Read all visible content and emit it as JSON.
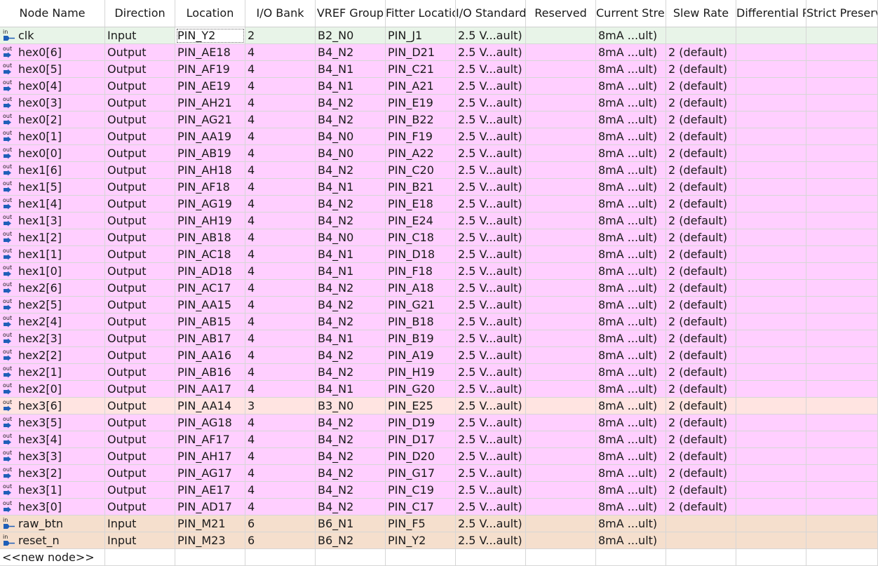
{
  "colors": {
    "input": "#e8f4e8",
    "output": "#ffcfff",
    "bank3": "#ffe4e1",
    "misc": "#f5dfcd",
    "icon": "#1f5fb8"
  },
  "columns": [
    {
      "label": "Node Name",
      "align": "center"
    },
    {
      "label": "Direction",
      "align": "center"
    },
    {
      "label": "Location",
      "align": "center"
    },
    {
      "label": "I/O Bank",
      "align": "center"
    },
    {
      "label": "VREF Group",
      "align": "clipl"
    },
    {
      "label": "Fitter Location",
      "align": "clipl"
    },
    {
      "label": "I/O Standard",
      "align": "clipl"
    },
    {
      "label": "Reserved",
      "align": "center"
    },
    {
      "label": "Current Strength",
      "align": "clipl"
    },
    {
      "label": "Slew Rate",
      "align": "center"
    },
    {
      "label": "Differential Pair",
      "align": "clipl"
    },
    {
      "label": "Strict Preservation",
      "align": "clipl"
    }
  ],
  "rows": [
    {
      "icon": "in",
      "name": "clk",
      "direction": "Input",
      "location": "PIN_Y2",
      "bank": "2",
      "vref": "B2_N0",
      "fitter": "PIN_J1",
      "iostd": "2.5 V...ault)",
      "reserved": "",
      "current": "8mA ...ult)",
      "slew": "",
      "diff": "",
      "strict": "",
      "color": "input",
      "selected": true
    },
    {
      "icon": "out",
      "name": "hex0[6]",
      "direction": "Output",
      "location": "PIN_AE18",
      "bank": "4",
      "vref": "B4_N2",
      "fitter": "PIN_D21",
      "iostd": "2.5 V...ault)",
      "reserved": "",
      "current": "8mA ...ult)",
      "slew": "2 (default)",
      "diff": "",
      "strict": "",
      "color": "output"
    },
    {
      "icon": "out",
      "name": "hex0[5]",
      "direction": "Output",
      "location": "PIN_AF19",
      "bank": "4",
      "vref": "B4_N1",
      "fitter": "PIN_C21",
      "iostd": "2.5 V...ault)",
      "reserved": "",
      "current": "8mA ...ult)",
      "slew": "2 (default)",
      "diff": "",
      "strict": "",
      "color": "output"
    },
    {
      "icon": "out",
      "name": "hex0[4]",
      "direction": "Output",
      "location": "PIN_AE19",
      "bank": "4",
      "vref": "B4_N1",
      "fitter": "PIN_A21",
      "iostd": "2.5 V...ault)",
      "reserved": "",
      "current": "8mA ...ult)",
      "slew": "2 (default)",
      "diff": "",
      "strict": "",
      "color": "output"
    },
    {
      "icon": "out",
      "name": "hex0[3]",
      "direction": "Output",
      "location": "PIN_AH21",
      "bank": "4",
      "vref": "B4_N2",
      "fitter": "PIN_E19",
      "iostd": "2.5 V...ault)",
      "reserved": "",
      "current": "8mA ...ult)",
      "slew": "2 (default)",
      "diff": "",
      "strict": "",
      "color": "output"
    },
    {
      "icon": "out",
      "name": "hex0[2]",
      "direction": "Output",
      "location": "PIN_AG21",
      "bank": "4",
      "vref": "B4_N2",
      "fitter": "PIN_B22",
      "iostd": "2.5 V...ault)",
      "reserved": "",
      "current": "8mA ...ult)",
      "slew": "2 (default)",
      "diff": "",
      "strict": "",
      "color": "output"
    },
    {
      "icon": "out",
      "name": "hex0[1]",
      "direction": "Output",
      "location": "PIN_AA19",
      "bank": "4",
      "vref": "B4_N0",
      "fitter": "PIN_F19",
      "iostd": "2.5 V...ault)",
      "reserved": "",
      "current": "8mA ...ult)",
      "slew": "2 (default)",
      "diff": "",
      "strict": "",
      "color": "output"
    },
    {
      "icon": "out",
      "name": "hex0[0]",
      "direction": "Output",
      "location": "PIN_AB19",
      "bank": "4",
      "vref": "B4_N0",
      "fitter": "PIN_A22",
      "iostd": "2.5 V...ault)",
      "reserved": "",
      "current": "8mA ...ult)",
      "slew": "2 (default)",
      "diff": "",
      "strict": "",
      "color": "output"
    },
    {
      "icon": "out",
      "name": "hex1[6]",
      "direction": "Output",
      "location": "PIN_AH18",
      "bank": "4",
      "vref": "B4_N2",
      "fitter": "PIN_C20",
      "iostd": "2.5 V...ault)",
      "reserved": "",
      "current": "8mA ...ult)",
      "slew": "2 (default)",
      "diff": "",
      "strict": "",
      "color": "output"
    },
    {
      "icon": "out",
      "name": "hex1[5]",
      "direction": "Output",
      "location": "PIN_AF18",
      "bank": "4",
      "vref": "B4_N1",
      "fitter": "PIN_B21",
      "iostd": "2.5 V...ault)",
      "reserved": "",
      "current": "8mA ...ult)",
      "slew": "2 (default)",
      "diff": "",
      "strict": "",
      "color": "output"
    },
    {
      "icon": "out",
      "name": "hex1[4]",
      "direction": "Output",
      "location": "PIN_AG19",
      "bank": "4",
      "vref": "B4_N2",
      "fitter": "PIN_E18",
      "iostd": "2.5 V...ault)",
      "reserved": "",
      "current": "8mA ...ult)",
      "slew": "2 (default)",
      "diff": "",
      "strict": "",
      "color": "output"
    },
    {
      "icon": "out",
      "name": "hex1[3]",
      "direction": "Output",
      "location": "PIN_AH19",
      "bank": "4",
      "vref": "B4_N2",
      "fitter": "PIN_E24",
      "iostd": "2.5 V...ault)",
      "reserved": "",
      "current": "8mA ...ult)",
      "slew": "2 (default)",
      "diff": "",
      "strict": "",
      "color": "output"
    },
    {
      "icon": "out",
      "name": "hex1[2]",
      "direction": "Output",
      "location": "PIN_AB18",
      "bank": "4",
      "vref": "B4_N0",
      "fitter": "PIN_C18",
      "iostd": "2.5 V...ault)",
      "reserved": "",
      "current": "8mA ...ult)",
      "slew": "2 (default)",
      "diff": "",
      "strict": "",
      "color": "output"
    },
    {
      "icon": "out",
      "name": "hex1[1]",
      "direction": "Output",
      "location": "PIN_AC18",
      "bank": "4",
      "vref": "B4_N1",
      "fitter": "PIN_D18",
      "iostd": "2.5 V...ault)",
      "reserved": "",
      "current": "8mA ...ult)",
      "slew": "2 (default)",
      "diff": "",
      "strict": "",
      "color": "output"
    },
    {
      "icon": "out",
      "name": "hex1[0]",
      "direction": "Output",
      "location": "PIN_AD18",
      "bank": "4",
      "vref": "B4_N1",
      "fitter": "PIN_F18",
      "iostd": "2.5 V...ault)",
      "reserved": "",
      "current": "8mA ...ult)",
      "slew": "2 (default)",
      "diff": "",
      "strict": "",
      "color": "output"
    },
    {
      "icon": "out",
      "name": "hex2[6]",
      "direction": "Output",
      "location": "PIN_AC17",
      "bank": "4",
      "vref": "B4_N2",
      "fitter": "PIN_A18",
      "iostd": "2.5 V...ault)",
      "reserved": "",
      "current": "8mA ...ult)",
      "slew": "2 (default)",
      "diff": "",
      "strict": "",
      "color": "output"
    },
    {
      "icon": "out",
      "name": "hex2[5]",
      "direction": "Output",
      "location": "PIN_AA15",
      "bank": "4",
      "vref": "B4_N2",
      "fitter": "PIN_G21",
      "iostd": "2.5 V...ault)",
      "reserved": "",
      "current": "8mA ...ult)",
      "slew": "2 (default)",
      "diff": "",
      "strict": "",
      "color": "output"
    },
    {
      "icon": "out",
      "name": "hex2[4]",
      "direction": "Output",
      "location": "PIN_AB15",
      "bank": "4",
      "vref": "B4_N2",
      "fitter": "PIN_B18",
      "iostd": "2.5 V...ault)",
      "reserved": "",
      "current": "8mA ...ult)",
      "slew": "2 (default)",
      "diff": "",
      "strict": "",
      "color": "output"
    },
    {
      "icon": "out",
      "name": "hex2[3]",
      "direction": "Output",
      "location": "PIN_AB17",
      "bank": "4",
      "vref": "B4_N1",
      "fitter": "PIN_B19",
      "iostd": "2.5 V...ault)",
      "reserved": "",
      "current": "8mA ...ult)",
      "slew": "2 (default)",
      "diff": "",
      "strict": "",
      "color": "output"
    },
    {
      "icon": "out",
      "name": "hex2[2]",
      "direction": "Output",
      "location": "PIN_AA16",
      "bank": "4",
      "vref": "B4_N2",
      "fitter": "PIN_A19",
      "iostd": "2.5 V...ault)",
      "reserved": "",
      "current": "8mA ...ult)",
      "slew": "2 (default)",
      "diff": "",
      "strict": "",
      "color": "output"
    },
    {
      "icon": "out",
      "name": "hex2[1]",
      "direction": "Output",
      "location": "PIN_AB16",
      "bank": "4",
      "vref": "B4_N2",
      "fitter": "PIN_H19",
      "iostd": "2.5 V...ault)",
      "reserved": "",
      "current": "8mA ...ult)",
      "slew": "2 (default)",
      "diff": "",
      "strict": "",
      "color": "output"
    },
    {
      "icon": "out",
      "name": "hex2[0]",
      "direction": "Output",
      "location": "PIN_AA17",
      "bank": "4",
      "vref": "B4_N1",
      "fitter": "PIN_G20",
      "iostd": "2.5 V...ault)",
      "reserved": "",
      "current": "8mA ...ult)",
      "slew": "2 (default)",
      "diff": "",
      "strict": "",
      "color": "output"
    },
    {
      "icon": "out",
      "name": "hex3[6]",
      "direction": "Output",
      "location": "PIN_AA14",
      "bank": "3",
      "vref": "B3_N0",
      "fitter": "PIN_E25",
      "iostd": "2.5 V...ault)",
      "reserved": "",
      "current": "8mA ...ult)",
      "slew": "2 (default)",
      "diff": "",
      "strict": "",
      "color": "bank3"
    },
    {
      "icon": "out",
      "name": "hex3[5]",
      "direction": "Output",
      "location": "PIN_AG18",
      "bank": "4",
      "vref": "B4_N2",
      "fitter": "PIN_D19",
      "iostd": "2.5 V...ault)",
      "reserved": "",
      "current": "8mA ...ult)",
      "slew": "2 (default)",
      "diff": "",
      "strict": "",
      "color": "output"
    },
    {
      "icon": "out",
      "name": "hex3[4]",
      "direction": "Output",
      "location": "PIN_AF17",
      "bank": "4",
      "vref": "B4_N2",
      "fitter": "PIN_D17",
      "iostd": "2.5 V...ault)",
      "reserved": "",
      "current": "8mA ...ult)",
      "slew": "2 (default)",
      "diff": "",
      "strict": "",
      "color": "output"
    },
    {
      "icon": "out",
      "name": "hex3[3]",
      "direction": "Output",
      "location": "PIN_AH17",
      "bank": "4",
      "vref": "B4_N2",
      "fitter": "PIN_D20",
      "iostd": "2.5 V...ault)",
      "reserved": "",
      "current": "8mA ...ult)",
      "slew": "2 (default)",
      "diff": "",
      "strict": "",
      "color": "output"
    },
    {
      "icon": "out",
      "name": "hex3[2]",
      "direction": "Output",
      "location": "PIN_AG17",
      "bank": "4",
      "vref": "B4_N2",
      "fitter": "PIN_G17",
      "iostd": "2.5 V...ault)",
      "reserved": "",
      "current": "8mA ...ult)",
      "slew": "2 (default)",
      "diff": "",
      "strict": "",
      "color": "output"
    },
    {
      "icon": "out",
      "name": "hex3[1]",
      "direction": "Output",
      "location": "PIN_AE17",
      "bank": "4",
      "vref": "B4_N2",
      "fitter": "PIN_C19",
      "iostd": "2.5 V...ault)",
      "reserved": "",
      "current": "8mA ...ult)",
      "slew": "2 (default)",
      "diff": "",
      "strict": "",
      "color": "output"
    },
    {
      "icon": "out",
      "name": "hex3[0]",
      "direction": "Output",
      "location": "PIN_AD17",
      "bank": "4",
      "vref": "B4_N2",
      "fitter": "PIN_C17",
      "iostd": "2.5 V...ault)",
      "reserved": "",
      "current": "8mA ...ult)",
      "slew": "2 (default)",
      "diff": "",
      "strict": "",
      "color": "output"
    },
    {
      "icon": "in",
      "name": "raw_btn",
      "direction": "Input",
      "location": "PIN_M21",
      "bank": "6",
      "vref": "B6_N1",
      "fitter": "PIN_F5",
      "iostd": "2.5 V...ault)",
      "reserved": "",
      "current": "8mA ...ult)",
      "slew": "",
      "diff": "",
      "strict": "",
      "color": "misc"
    },
    {
      "icon": "in",
      "name": "reset_n",
      "direction": "Input",
      "location": "PIN_M23",
      "bank": "6",
      "vref": "B6_N2",
      "fitter": "PIN_Y2",
      "iostd": "2.5 V...ault)",
      "reserved": "",
      "current": "8mA ...ult)",
      "slew": "",
      "diff": "",
      "strict": "",
      "color": "misc"
    }
  ],
  "new_node_label": "<<new node>>"
}
